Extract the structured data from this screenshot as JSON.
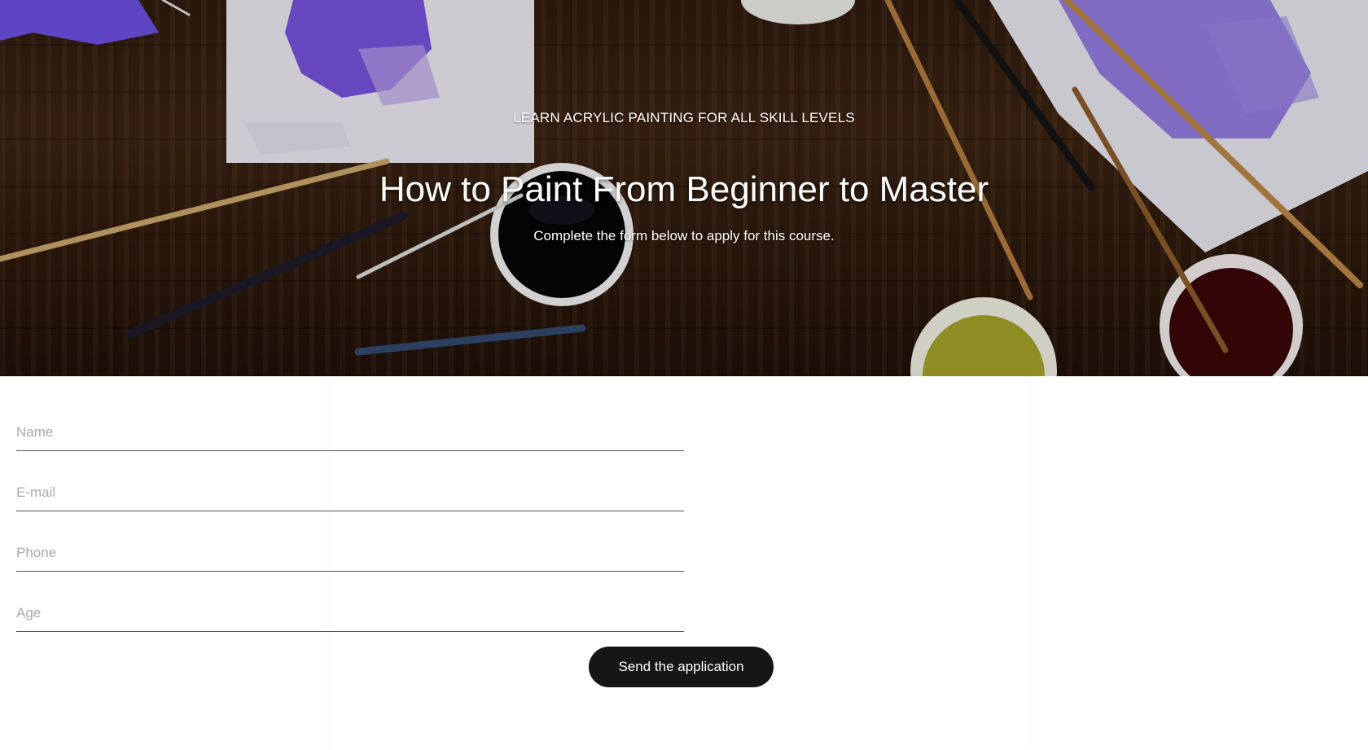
{
  "hero": {
    "kicker": "LEARN ACRYLIC PAINTING FOR ALL SKILL LEVELS",
    "title": "How to Paint From Beginner to Master",
    "subtitle": "Complete the form below to apply for this course."
  },
  "form": {
    "name_placeholder": "Name",
    "email_placeholder": "E-mail",
    "phone_placeholder": "Phone",
    "age_placeholder": "Age",
    "submit_label": "Send the application"
  },
  "colors": {
    "button_bg": "#161616",
    "paint_purple": "#6a4fd8",
    "wood": "#3a2212"
  }
}
